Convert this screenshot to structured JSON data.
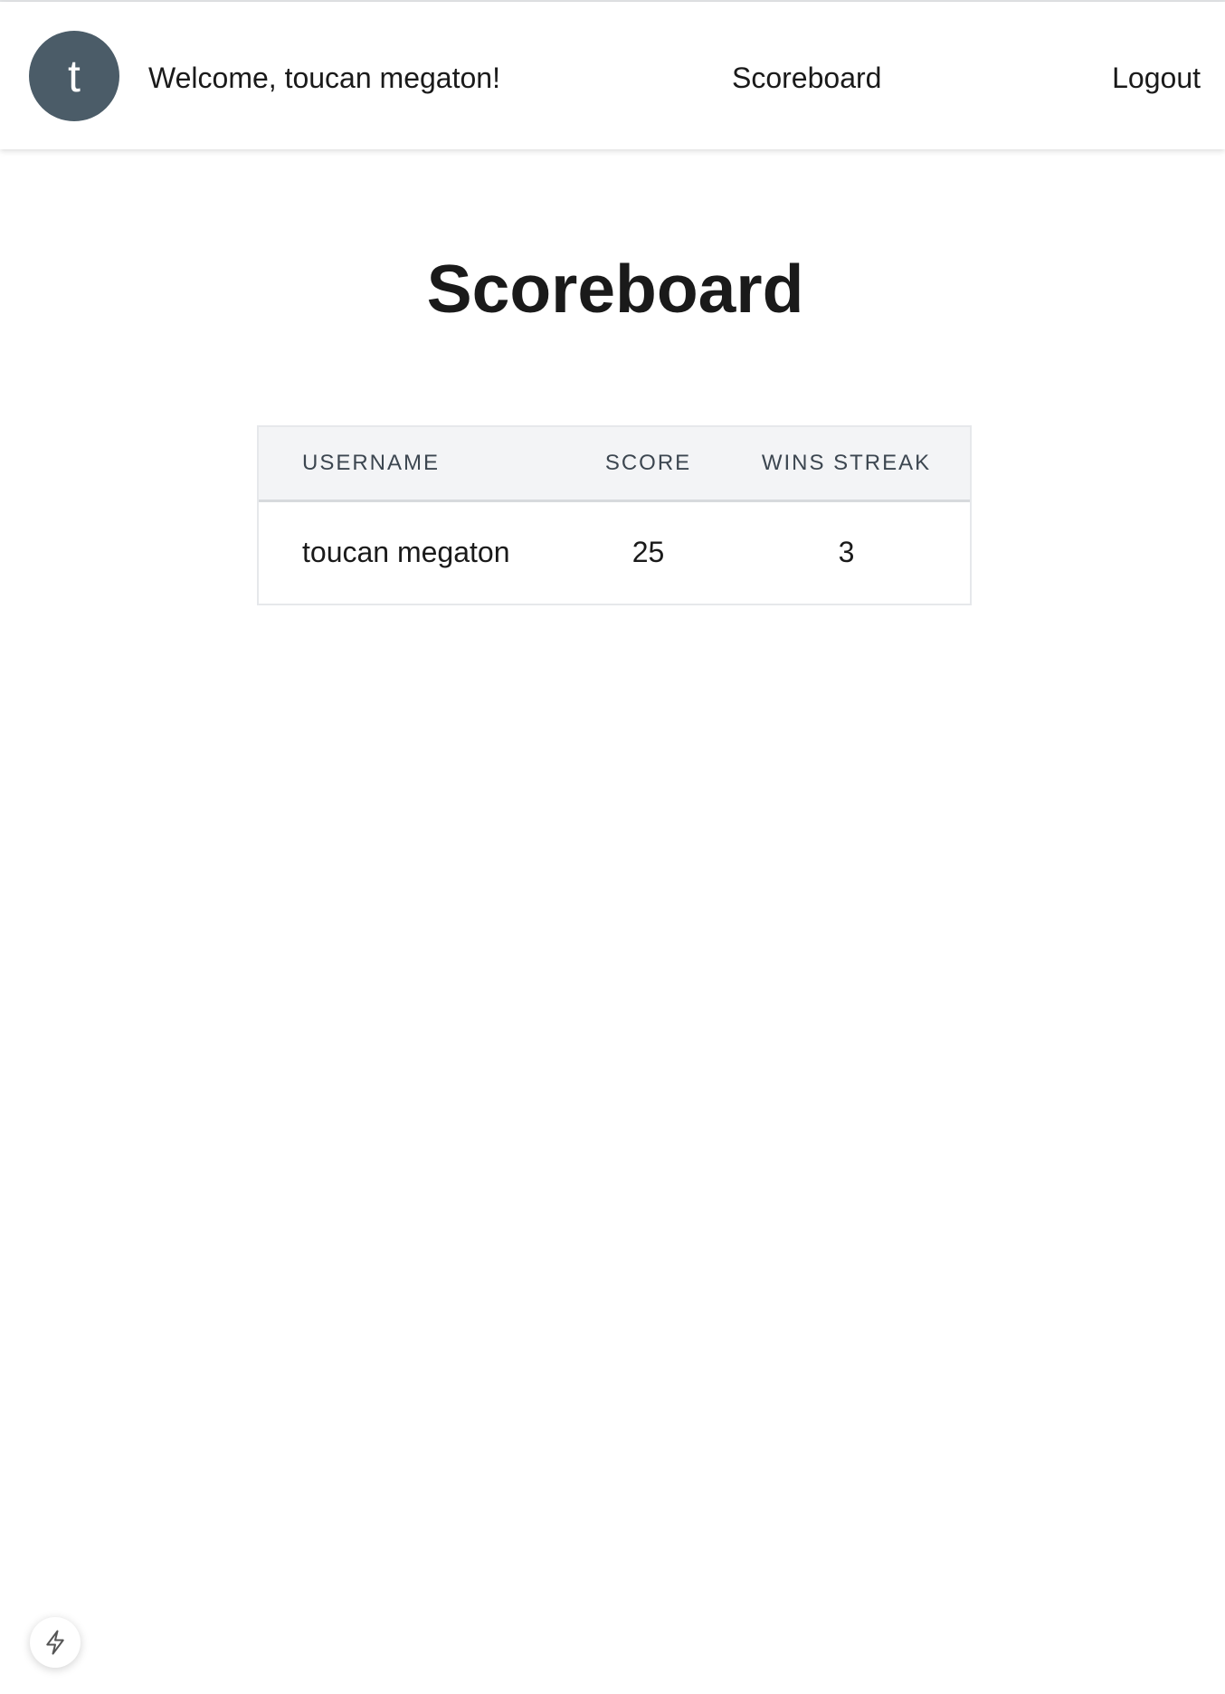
{
  "header": {
    "avatar_initial": "t",
    "welcome_text": "Welcome, toucan megaton!",
    "nav": {
      "scoreboard_label": "Scoreboard",
      "logout_label": "Logout"
    }
  },
  "main": {
    "title": "Scoreboard",
    "table": {
      "columns": [
        "USERNAME",
        "SCORE",
        "WINS STREAK"
      ],
      "rows": [
        {
          "username": "toucan megaton",
          "score": "25",
          "wins_streak": "3"
        }
      ]
    }
  },
  "floating_action": {
    "icon": "lightning-bolt-icon"
  },
  "colors": {
    "avatar_bg": "#4b5c68",
    "table_header_bg": "#f3f4f6",
    "text": "#1a1a1a"
  }
}
